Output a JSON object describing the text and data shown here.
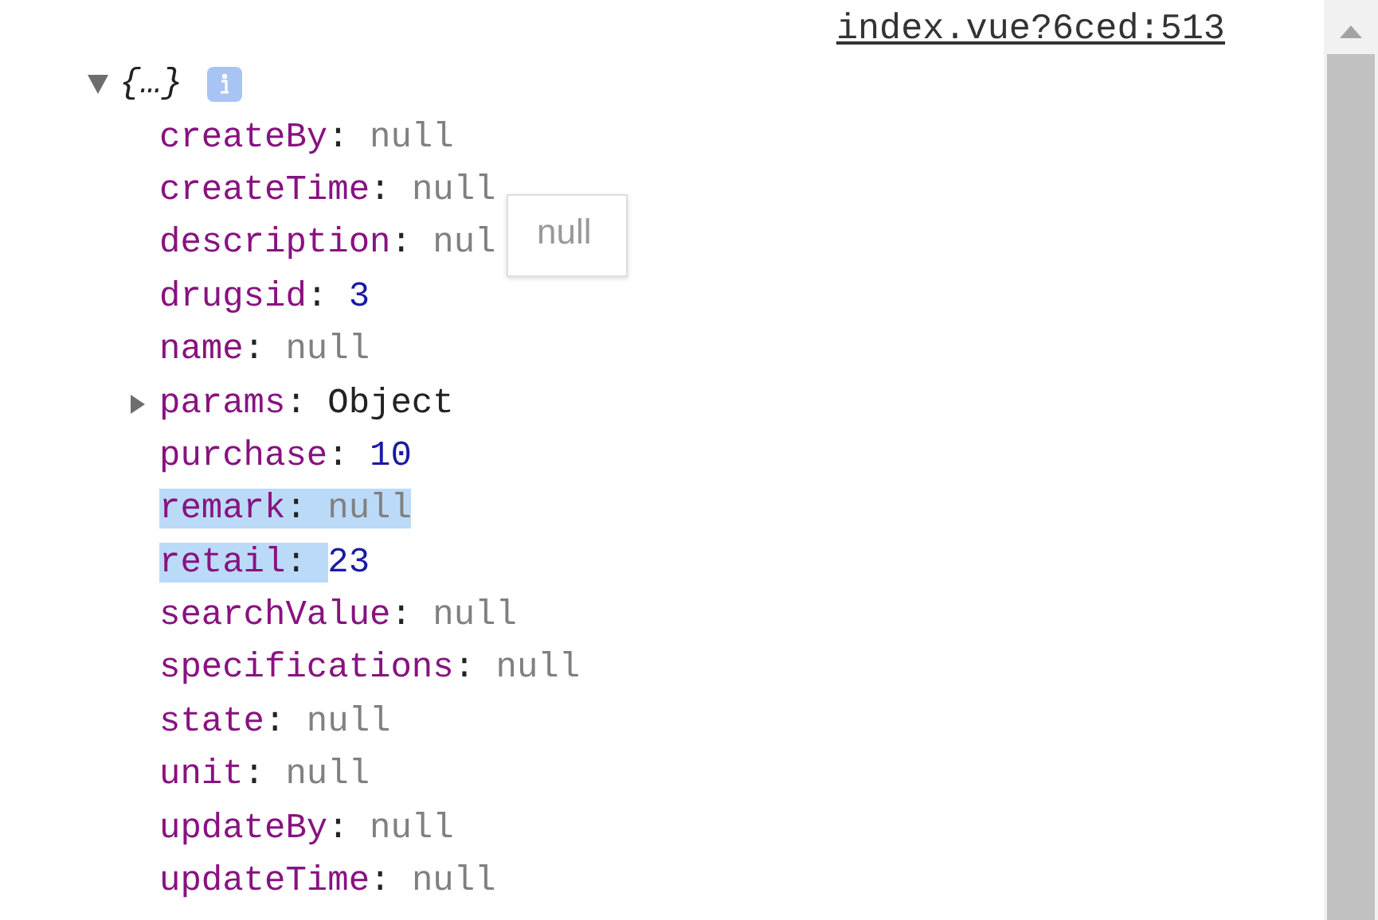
{
  "source_link": "index.vue?6ced:513",
  "separator": ":",
  "object": {
    "summary": "{…}",
    "expanded": true,
    "properties": [
      {
        "key": "createBy",
        "kind": "null",
        "value": "null",
        "selected": false
      },
      {
        "key": "createTime",
        "kind": "null",
        "value": "null",
        "selected": false
      },
      {
        "key": "description",
        "kind": "null",
        "value": "nul",
        "selected": false
      },
      {
        "key": "drugsid",
        "kind": "number",
        "value": "3",
        "selected": false
      },
      {
        "key": "name",
        "kind": "null",
        "value": "null",
        "selected": false
      },
      {
        "key": "params",
        "kind": "object",
        "value": "Object",
        "expanded": false,
        "selected": false
      },
      {
        "key": "purchase",
        "kind": "number",
        "value": "10",
        "selected": false
      },
      {
        "key": "remark",
        "kind": "null",
        "value": "null",
        "selected": true
      },
      {
        "key": "retail",
        "kind": "number",
        "value": "23",
        "selected": true
      },
      {
        "key": "searchValue",
        "kind": "null",
        "value": "null",
        "selected": false
      },
      {
        "key": "specifications",
        "kind": "null",
        "value": "null",
        "selected": false
      },
      {
        "key": "state",
        "kind": "null",
        "value": "null",
        "selected": false
      },
      {
        "key": "unit",
        "kind": "null",
        "value": "null",
        "selected": false
      },
      {
        "key": "updateBy",
        "kind": "null",
        "value": "null",
        "selected": false
      },
      {
        "key": "updateTime",
        "kind": "null",
        "value": "null",
        "selected": false
      }
    ]
  },
  "tooltip": "null"
}
